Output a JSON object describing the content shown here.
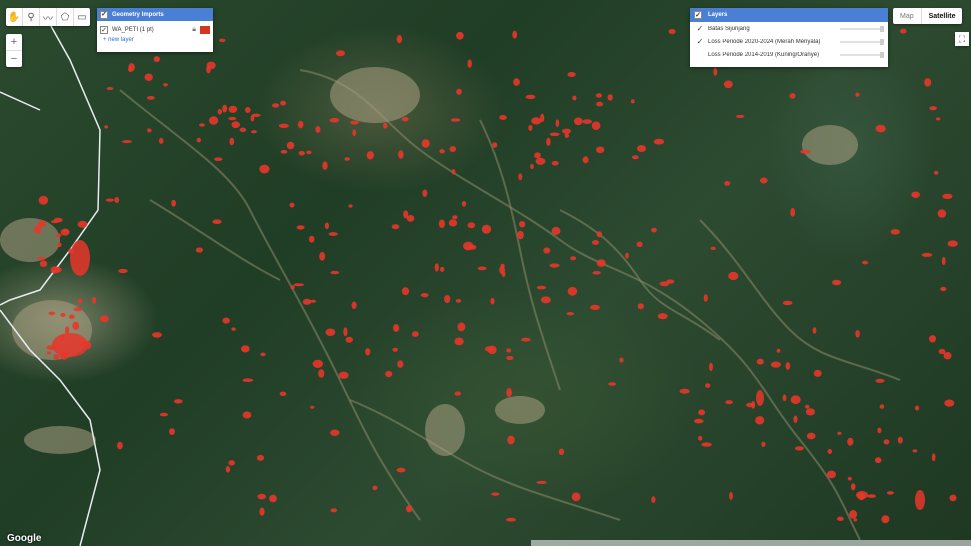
{
  "map": {
    "google_logo": "Google",
    "map_type": {
      "options": [
        "Map",
        "Satellite"
      ],
      "selected": "Satellite"
    },
    "loss_color": "#e8362a",
    "boundary_color": "#e9ecf2"
  },
  "geometry_imports": {
    "title": "Geometry Imports",
    "layer": {
      "name": "WA_PETI (1 pt)",
      "color": "#d0391f"
    },
    "new_layer_link": "+ new layer"
  },
  "layers_panel": {
    "title": "Layers",
    "items": [
      {
        "label": "Batas Sijunjang",
        "checked": true
      },
      {
        "label": "Loss Periode 2020-2024 (Merah Menyala)",
        "checked": true
      },
      {
        "label": "Loss Periode 2014-2019 (Kuning/Oranye)",
        "checked": false
      }
    ]
  },
  "icons": {
    "toolbar": [
      "hand-icon",
      "marker-icon",
      "polyline-icon",
      "polygon-icon",
      "rectangle-icon"
    ],
    "zoom": [
      "zoom-in-icon",
      "zoom-out-icon"
    ],
    "fullscreen": "fullscreen-icon"
  }
}
